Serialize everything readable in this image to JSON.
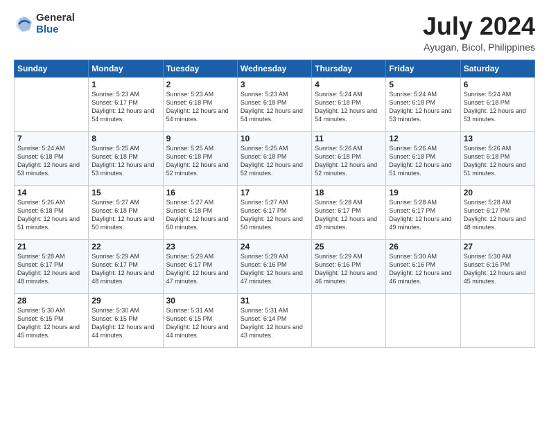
{
  "logo": {
    "general": "General",
    "blue": "Blue"
  },
  "header": {
    "month": "July 2024",
    "location": "Ayugan, Bicol, Philippines"
  },
  "days_of_week": [
    "Sunday",
    "Monday",
    "Tuesday",
    "Wednesday",
    "Thursday",
    "Friday",
    "Saturday"
  ],
  "weeks": [
    [
      {
        "day": "",
        "sunrise": "",
        "sunset": "",
        "daylight": ""
      },
      {
        "day": "1",
        "sunrise": "Sunrise: 5:23 AM",
        "sunset": "Sunset: 6:17 PM",
        "daylight": "Daylight: 12 hours and 54 minutes."
      },
      {
        "day": "2",
        "sunrise": "Sunrise: 5:23 AM",
        "sunset": "Sunset: 6:18 PM",
        "daylight": "Daylight: 12 hours and 54 minutes."
      },
      {
        "day": "3",
        "sunrise": "Sunrise: 5:23 AM",
        "sunset": "Sunset: 6:18 PM",
        "daylight": "Daylight: 12 hours and 54 minutes."
      },
      {
        "day": "4",
        "sunrise": "Sunrise: 5:24 AM",
        "sunset": "Sunset: 6:18 PM",
        "daylight": "Daylight: 12 hours and 54 minutes."
      },
      {
        "day": "5",
        "sunrise": "Sunrise: 5:24 AM",
        "sunset": "Sunset: 6:18 PM",
        "daylight": "Daylight: 12 hours and 53 minutes."
      },
      {
        "day": "6",
        "sunrise": "Sunrise: 5:24 AM",
        "sunset": "Sunset: 6:18 PM",
        "daylight": "Daylight: 12 hours and 53 minutes."
      }
    ],
    [
      {
        "day": "7",
        "sunrise": "Sunrise: 5:24 AM",
        "sunset": "Sunset: 6:18 PM",
        "daylight": "Daylight: 12 hours and 53 minutes."
      },
      {
        "day": "8",
        "sunrise": "Sunrise: 5:25 AM",
        "sunset": "Sunset: 6:18 PM",
        "daylight": "Daylight: 12 hours and 53 minutes."
      },
      {
        "day": "9",
        "sunrise": "Sunrise: 5:25 AM",
        "sunset": "Sunset: 6:18 PM",
        "daylight": "Daylight: 12 hours and 52 minutes."
      },
      {
        "day": "10",
        "sunrise": "Sunrise: 5:25 AM",
        "sunset": "Sunset: 6:18 PM",
        "daylight": "Daylight: 12 hours and 52 minutes."
      },
      {
        "day": "11",
        "sunrise": "Sunrise: 5:26 AM",
        "sunset": "Sunset: 6:18 PM",
        "daylight": "Daylight: 12 hours and 52 minutes."
      },
      {
        "day": "12",
        "sunrise": "Sunrise: 5:26 AM",
        "sunset": "Sunset: 6:18 PM",
        "daylight": "Daylight: 12 hours and 51 minutes."
      },
      {
        "day": "13",
        "sunrise": "Sunrise: 5:26 AM",
        "sunset": "Sunset: 6:18 PM",
        "daylight": "Daylight: 12 hours and 51 minutes."
      }
    ],
    [
      {
        "day": "14",
        "sunrise": "Sunrise: 5:26 AM",
        "sunset": "Sunset: 6:18 PM",
        "daylight": "Daylight: 12 hours and 51 minutes."
      },
      {
        "day": "15",
        "sunrise": "Sunrise: 5:27 AM",
        "sunset": "Sunset: 6:18 PM",
        "daylight": "Daylight: 12 hours and 50 minutes."
      },
      {
        "day": "16",
        "sunrise": "Sunrise: 5:27 AM",
        "sunset": "Sunset: 6:18 PM",
        "daylight": "Daylight: 12 hours and 50 minutes."
      },
      {
        "day": "17",
        "sunrise": "Sunrise: 5:27 AM",
        "sunset": "Sunset: 6:17 PM",
        "daylight": "Daylight: 12 hours and 50 minutes."
      },
      {
        "day": "18",
        "sunrise": "Sunrise: 5:28 AM",
        "sunset": "Sunset: 6:17 PM",
        "daylight": "Daylight: 12 hours and 49 minutes."
      },
      {
        "day": "19",
        "sunrise": "Sunrise: 5:28 AM",
        "sunset": "Sunset: 6:17 PM",
        "daylight": "Daylight: 12 hours and 49 minutes."
      },
      {
        "day": "20",
        "sunrise": "Sunrise: 5:28 AM",
        "sunset": "Sunset: 6:17 PM",
        "daylight": "Daylight: 12 hours and 48 minutes."
      }
    ],
    [
      {
        "day": "21",
        "sunrise": "Sunrise: 5:28 AM",
        "sunset": "Sunset: 6:17 PM",
        "daylight": "Daylight: 12 hours and 48 minutes."
      },
      {
        "day": "22",
        "sunrise": "Sunrise: 5:29 AM",
        "sunset": "Sunset: 6:17 PM",
        "daylight": "Daylight: 12 hours and 48 minutes."
      },
      {
        "day": "23",
        "sunrise": "Sunrise: 5:29 AM",
        "sunset": "Sunset: 6:17 PM",
        "daylight": "Daylight: 12 hours and 47 minutes."
      },
      {
        "day": "24",
        "sunrise": "Sunrise: 5:29 AM",
        "sunset": "Sunset: 6:16 PM",
        "daylight": "Daylight: 12 hours and 47 minutes."
      },
      {
        "day": "25",
        "sunrise": "Sunrise: 5:29 AM",
        "sunset": "Sunset: 6:16 PM",
        "daylight": "Daylight: 12 hours and 46 minutes."
      },
      {
        "day": "26",
        "sunrise": "Sunrise: 5:30 AM",
        "sunset": "Sunset: 6:16 PM",
        "daylight": "Daylight: 12 hours and 46 minutes."
      },
      {
        "day": "27",
        "sunrise": "Sunrise: 5:30 AM",
        "sunset": "Sunset: 6:16 PM",
        "daylight": "Daylight: 12 hours and 45 minutes."
      }
    ],
    [
      {
        "day": "28",
        "sunrise": "Sunrise: 5:30 AM",
        "sunset": "Sunset: 6:15 PM",
        "daylight": "Daylight: 12 hours and 45 minutes."
      },
      {
        "day": "29",
        "sunrise": "Sunrise: 5:30 AM",
        "sunset": "Sunset: 6:15 PM",
        "daylight": "Daylight: 12 hours and 44 minutes."
      },
      {
        "day": "30",
        "sunrise": "Sunrise: 5:31 AM",
        "sunset": "Sunset: 6:15 PM",
        "daylight": "Daylight: 12 hours and 44 minutes."
      },
      {
        "day": "31",
        "sunrise": "Sunrise: 5:31 AM",
        "sunset": "Sunset: 6:14 PM",
        "daylight": "Daylight: 12 hours and 43 minutes."
      },
      {
        "day": "",
        "sunrise": "",
        "sunset": "",
        "daylight": ""
      },
      {
        "day": "",
        "sunrise": "",
        "sunset": "",
        "daylight": ""
      },
      {
        "day": "",
        "sunrise": "",
        "sunset": "",
        "daylight": ""
      }
    ]
  ]
}
